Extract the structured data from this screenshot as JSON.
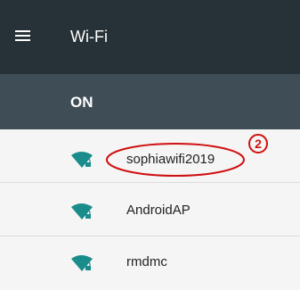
{
  "app_bar": {
    "menu_icon": "hamburger-menu-icon",
    "title": "Wi-Fi"
  },
  "toggle_bar": {
    "state_label": "ON"
  },
  "networks": [
    {
      "ssid": "sophiawifi2019",
      "icon": "wifi-locked-icon",
      "highlighted": true
    },
    {
      "ssid": "AndroidAP",
      "icon": "wifi-locked-icon",
      "highlighted": false
    },
    {
      "ssid": "rmdmc",
      "icon": "wifi-locked-icon",
      "highlighted": false
    }
  ],
  "annotation": {
    "marker": "2",
    "color": "#d01010"
  },
  "colors": {
    "app_bar": "#273238",
    "toggle_bar": "#3f4e56",
    "list_bg": "#f5f5f5",
    "wifi_icon": "#1a8c8c"
  }
}
